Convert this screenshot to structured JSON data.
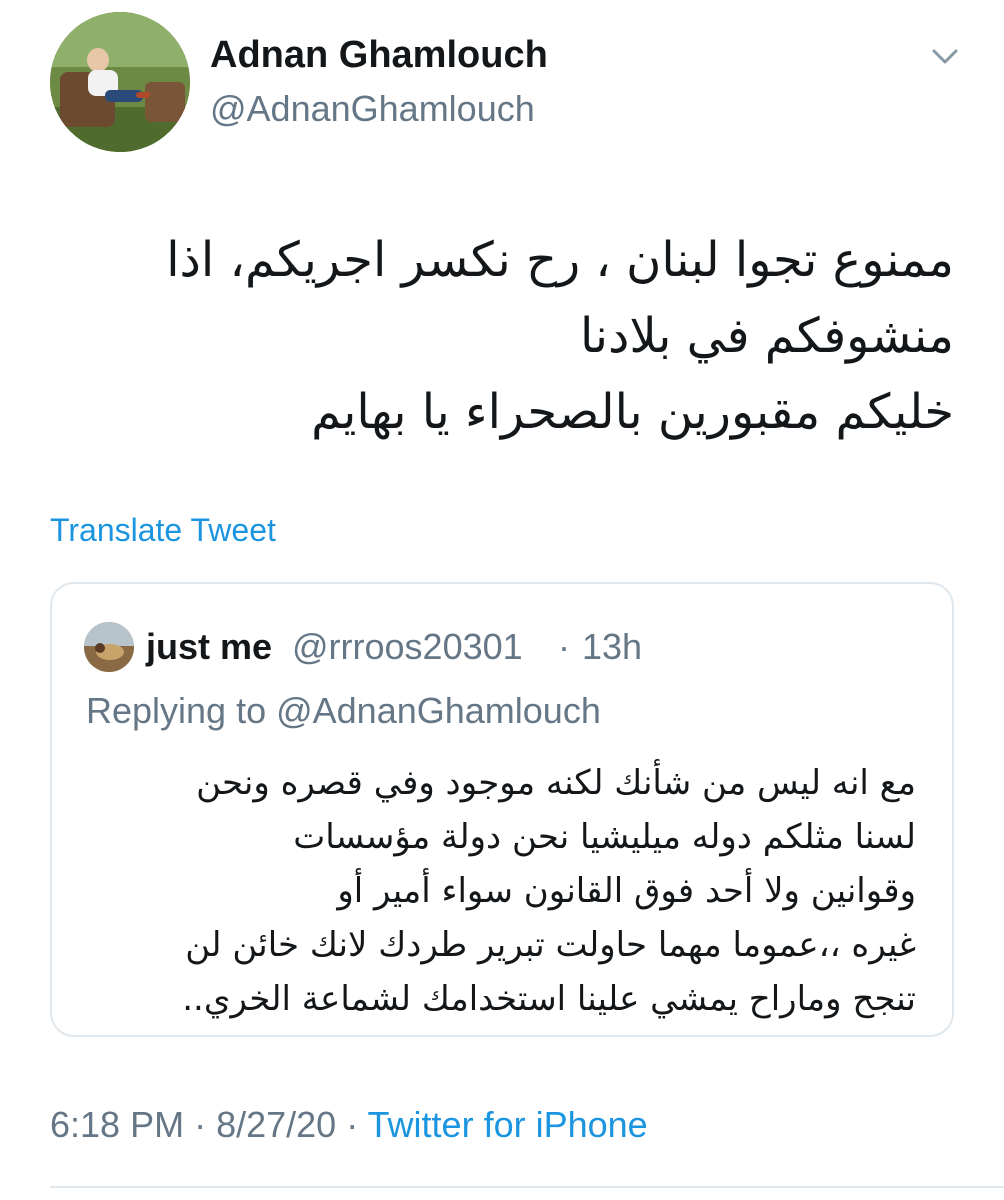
{
  "author": {
    "display_name": "Adnan Ghamlouch",
    "handle": "@AdnanGhamlouch",
    "avatar_icon": "profile-photo-icon"
  },
  "menu_icon": "chevron-down-icon",
  "tweet": {
    "lines": [
      "ممنوع تجوا لبنان ، رح نكسر اجريكم، اذا",
      "منشوفكم في بلادنا",
      "خليكم مقبورين بالصحراء يا بهايم"
    ]
  },
  "translate_label": "Translate Tweet",
  "quoted": {
    "display_name": "just me",
    "handle": "@rrroos20301",
    "separator": "·",
    "time_ago": "13h",
    "replying_to": "Replying to @AdnanGhamlouch",
    "lines": [
      "مع انه ليس من شأنك لكنه موجود وفي قصره ونحن",
      "لسنا مثلكم دوله ميليشيا نحن دولة مؤسسات",
      "وقوانين ولا أحد فوق القانون سواء أمير أو",
      "غيره ،،عموما مهما حاولت تبرير طردك لانك خائن لن",
      "تنجح وماراح يمشي علينا استخدامك لشماعة الخري.."
    ]
  },
  "meta": {
    "time": "6:18 PM",
    "separator": " · ",
    "date": "8/27/20",
    "separator2": " · ",
    "source": "Twitter for iPhone"
  },
  "colors": {
    "link": "#1b95e0",
    "secondary_text": "#657786",
    "border": "#e1e8ed"
  }
}
